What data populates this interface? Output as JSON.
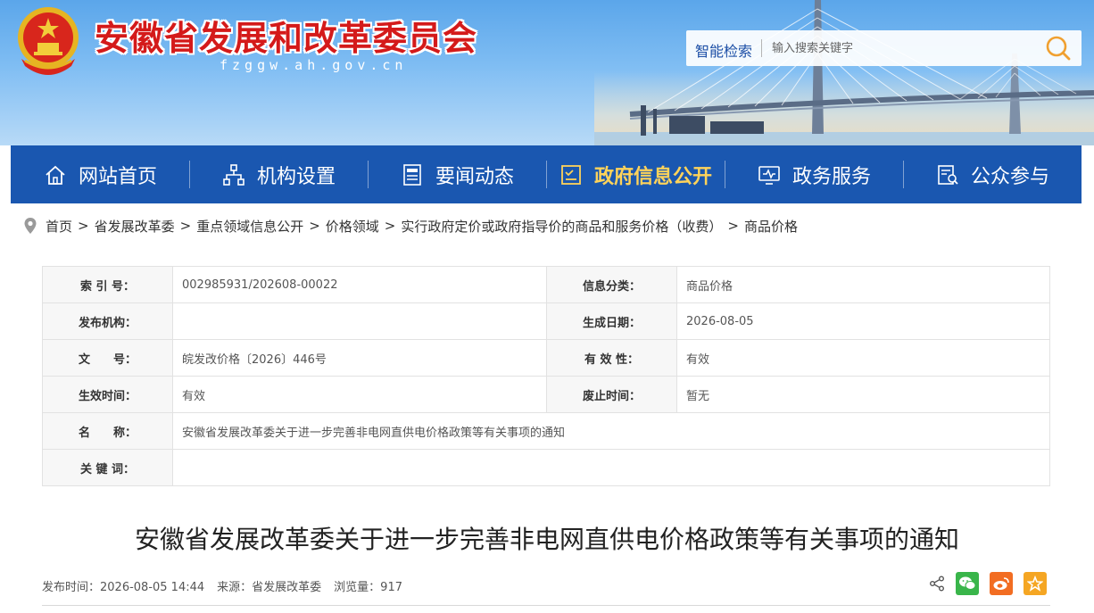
{
  "header": {
    "site_title": "安徽省发展和改革委员会",
    "domain": "fzggw.ah.gov.cn",
    "search_label": "智能检索",
    "search_placeholder": "输入搜索关键字"
  },
  "colors": {
    "nav_bg": "#1a57b0",
    "nav_active": "#ffd35a",
    "title_red": "#d41a1a"
  },
  "nav": {
    "items": [
      {
        "label": "网站首页",
        "icon": "home-icon"
      },
      {
        "label": "机构设置",
        "icon": "org-chart-icon"
      },
      {
        "label": "要闻动态",
        "icon": "news-icon"
      },
      {
        "label": "政府信息公开",
        "icon": "info-disclosure-icon",
        "active": true
      },
      {
        "label": "政务服务",
        "icon": "monitor-icon"
      },
      {
        "label": "公众参与",
        "icon": "participation-icon"
      }
    ]
  },
  "breadcrumb": {
    "items": [
      "首页",
      "省发展改革委",
      "重点领域信息公开",
      "价格领域",
      "实行政府定价或政府指导价的商品和服务价格（收费）",
      "商品价格"
    ],
    "separator": ">"
  },
  "info": {
    "index_label": "索 引 号：",
    "index_value": "002985931/202608-00022",
    "category_label": "信息分类：",
    "category_value": "商品价格",
    "publisher_label": "发布机构：",
    "publisher_value": "",
    "date_label": "生成日期：",
    "date_value": "2026-08-05",
    "docno_label": "文　　号：",
    "docno_value": "皖发改价格〔2026〕446号",
    "validity_label": "有 效 性：",
    "validity_value": "有效",
    "effective_label": "生效时间：",
    "effective_value": "有效",
    "repeal_label": "废止时间：",
    "repeal_value": "暂无",
    "name_label": "名　　称：",
    "name_value": "安徽省发展改革委关于进一步完善非电网直供电价格政策等有关事项的通知",
    "keywords_label": "关 键 词：",
    "keywords_value": ""
  },
  "article": {
    "title": "安徽省发展改革委关于进一步完善非电网直供电价格政策等有关事项的通知",
    "publish_time": "发布时间：2026-08-05 14:44",
    "source": "来源：省发展改革委",
    "views": "浏览量：917"
  }
}
